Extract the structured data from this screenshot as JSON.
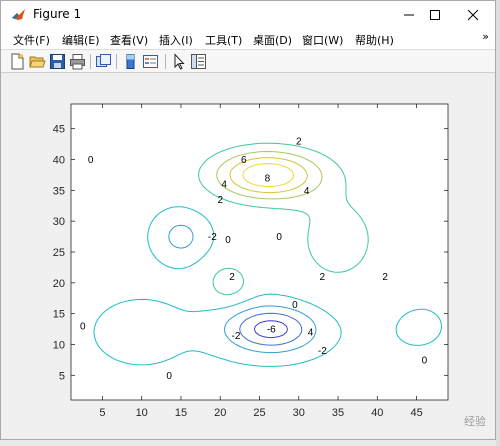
{
  "window": {
    "title": "Figure 1"
  },
  "menu": {
    "items": [
      {
        "label": "文件(F)"
      },
      {
        "label": "编辑(E)"
      },
      {
        "label": "查看(V)"
      },
      {
        "label": "插入(I)"
      },
      {
        "label": "工具(T)"
      },
      {
        "label": "桌面(D)"
      },
      {
        "label": "窗口(W)"
      },
      {
        "label": "帮助(H)"
      }
    ],
    "more": "»"
  },
  "toolbar": {
    "buttons": [
      "new-figure-icon",
      "open-file-icon",
      "save-icon",
      "print-icon",
      "link-plot-icon",
      "colorbar-icon",
      "legend-icon",
      "pointer-icon",
      "property-inspector-icon"
    ]
  },
  "chart_data": {
    "type": "contour",
    "title": "",
    "xlabel": "",
    "ylabel": "",
    "xlim": [
      1,
      49
    ],
    "ylim": [
      1,
      49
    ],
    "xticks": [
      "5",
      "10",
      "15",
      "20",
      "25",
      "30",
      "35",
      "40",
      "45"
    ],
    "yticks": [
      "5",
      "10",
      "15",
      "20",
      "25",
      "30",
      "35",
      "40",
      "45"
    ],
    "colormap": "parula",
    "levels": [
      -6,
      -4,
      -2,
      0,
      2,
      4,
      6,
      8
    ],
    "level_colors": {
      "-6": "#3d3fc9",
      "-4": "#3c6fd8",
      "-2": "#2f9ed6",
      "0": "#1dbcc5",
      "2": "#3ec99a",
      "4": "#a6c85a",
      "6": "#d7c23a",
      "8": "#ecd83a"
    },
    "contour_labels": [
      {
        "text": "0",
        "x": 3.5,
        "y": 40
      },
      {
        "text": "0",
        "x": 2.5,
        "y": 13
      },
      {
        "text": "2",
        "x": 30,
        "y": 43
      },
      {
        "text": "6",
        "x": 23,
        "y": 40
      },
      {
        "text": "8",
        "x": 26,
        "y": 37
      },
      {
        "text": "4",
        "x": 20.5,
        "y": 36
      },
      {
        "text": "2",
        "x": 20,
        "y": 33.5
      },
      {
        "text": "4",
        "x": 31,
        "y": 35
      },
      {
        "text": "-2",
        "x": 19,
        "y": 27.5
      },
      {
        "text": "0",
        "x": 21,
        "y": 27
      },
      {
        "text": "0",
        "x": 27.5,
        "y": 27.5
      },
      {
        "text": "2",
        "x": 21.5,
        "y": 21
      },
      {
        "text": "2",
        "x": 33,
        "y": 21
      },
      {
        "text": "2",
        "x": 41,
        "y": 21
      },
      {
        "text": "0",
        "x": 29.5,
        "y": 16.5
      },
      {
        "text": "-6",
        "x": 26.5,
        "y": 12.5
      },
      {
        "text": "-2",
        "x": 22,
        "y": 11.5
      },
      {
        "text": "4",
        "x": 31.5,
        "y": 12
      },
      {
        "text": "-2",
        "x": 33,
        "y": 9
      },
      {
        "text": "0",
        "x": 13.5,
        "y": 5
      },
      {
        "text": "0",
        "x": 46,
        "y": 7.5
      }
    ]
  },
  "watermark": "经验"
}
